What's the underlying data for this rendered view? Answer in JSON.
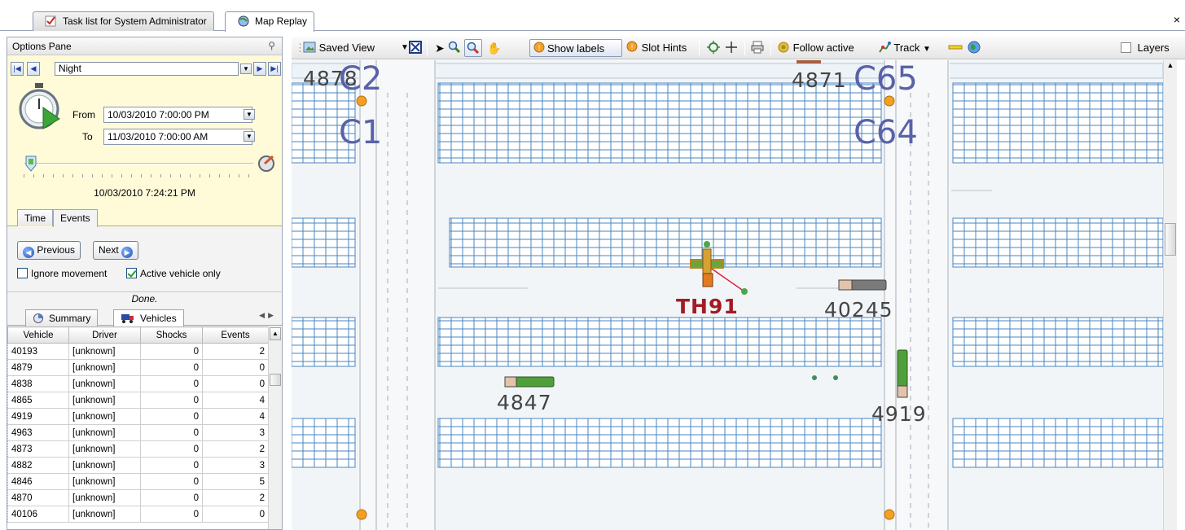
{
  "doc_tabs": [
    {
      "label": "Task list for System Administrator"
    },
    {
      "label": "Map Replay"
    }
  ],
  "close_label": "×",
  "options_pane": {
    "title": "Options Pane",
    "preset": "Night",
    "from_label": "From",
    "from_value": "10/03/2010  7:00:00 PM",
    "to_label": "To",
    "to_value": "11/03/2010  7:00:00 AM",
    "current_time": "10/03/2010 7:24:21 PM",
    "slider_position": 0.03,
    "tabs": [
      "Time",
      "Events"
    ],
    "active_tab": "Events",
    "previous_label": "Previous",
    "next_label": "Next",
    "ignore_movement_label": "Ignore movement",
    "ignore_movement_checked": false,
    "active_vehicle_only_label": "Active vehicle only",
    "active_vehicle_only_checked": true,
    "status": "Done."
  },
  "lower_tabs": [
    {
      "label": "Summary"
    },
    {
      "label": "Vehicles"
    }
  ],
  "grid": {
    "columns": [
      "Vehicle",
      "Driver",
      "Shocks",
      "Events"
    ],
    "rows": [
      [
        "40193",
        "[unknown]",
        "0",
        "2"
      ],
      [
        "4879",
        "[unknown]",
        "0",
        "0"
      ],
      [
        "4838",
        "[unknown]",
        "0",
        "0"
      ],
      [
        "4865",
        "[unknown]",
        "0",
        "4"
      ],
      [
        "4919",
        "[unknown]",
        "0",
        "4"
      ],
      [
        "4963",
        "[unknown]",
        "0",
        "3"
      ],
      [
        "4873",
        "[unknown]",
        "0",
        "2"
      ],
      [
        "4882",
        "[unknown]",
        "0",
        "3"
      ],
      [
        "4846",
        "[unknown]",
        "0",
        "5"
      ],
      [
        "4870",
        "[unknown]",
        "0",
        "2"
      ],
      [
        "40106",
        "[unknown]",
        "0",
        "0"
      ]
    ]
  },
  "toolbar": {
    "saved_view": "Saved View",
    "show_labels": "Show labels",
    "slot_hints": "Slot Hints",
    "follow_active": "Follow active",
    "track": "Track",
    "layers": "Layers"
  },
  "map": {
    "zones": [
      "C1",
      "C2",
      "C64",
      "C65"
    ],
    "vehicles": [
      {
        "id": "4878"
      },
      {
        "id": "4871"
      },
      {
        "id": "TH91",
        "active": true
      },
      {
        "id": "40245"
      },
      {
        "id": "4847"
      },
      {
        "id": "4919"
      }
    ]
  },
  "colors": {
    "slot_blue": "#4a86c0",
    "active_label": "#a31b23",
    "zone_label": "#5962a8",
    "time_panel": "#fffbd9"
  }
}
